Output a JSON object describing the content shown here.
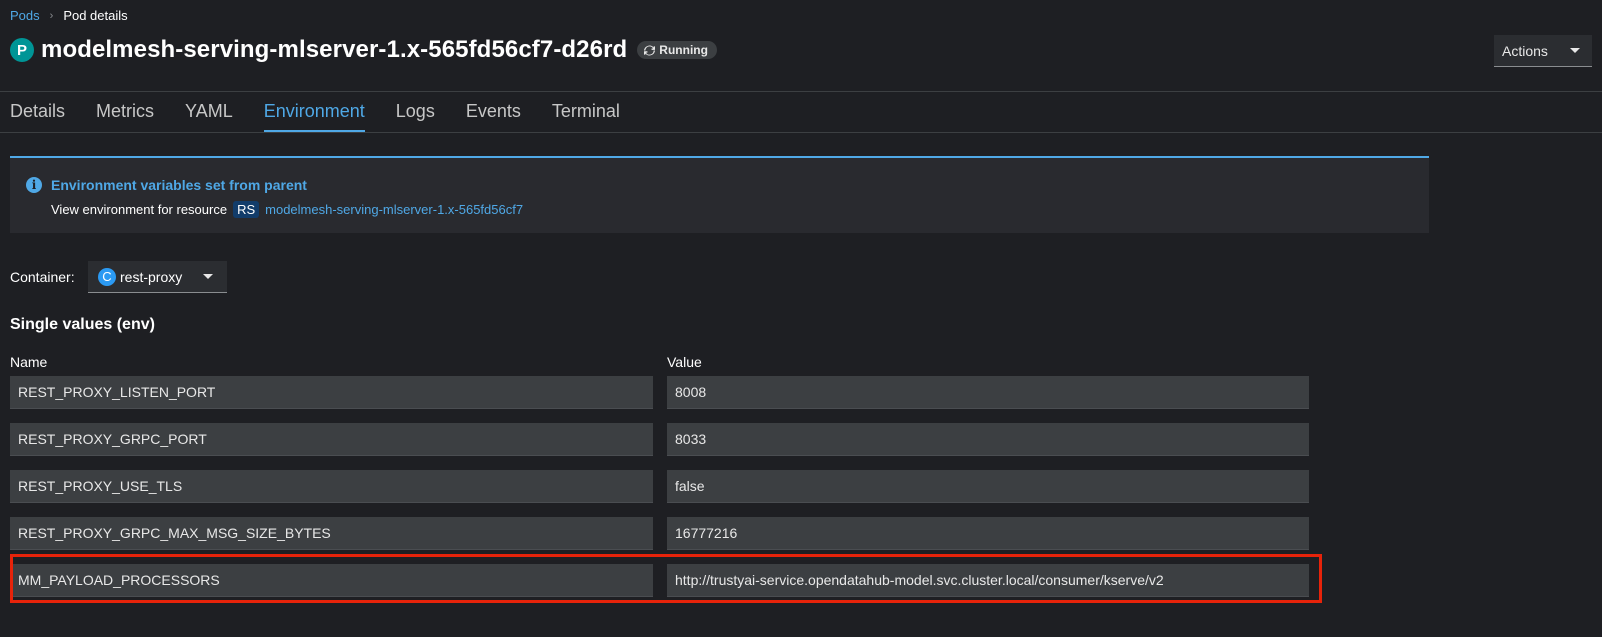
{
  "breadcrumb": {
    "parent": "Pods",
    "current": "Pod details"
  },
  "header": {
    "badge": "P",
    "title": "modelmesh-serving-mlserver-1.x-565fd56cf7-d26rd",
    "status": "Running",
    "actions_label": "Actions"
  },
  "tabs": [
    {
      "label": "Details"
    },
    {
      "label": "Metrics"
    },
    {
      "label": "YAML"
    },
    {
      "label": "Environment"
    },
    {
      "label": "Logs"
    },
    {
      "label": "Events"
    },
    {
      "label": "Terminal"
    }
  ],
  "active_tab": "Environment",
  "alert": {
    "title": "Environment variables set from parent",
    "body_prefix": "View environment for resource",
    "resource_badge": "RS",
    "resource_link": "modelmesh-serving-mlserver-1.x-565fd56cf7"
  },
  "container": {
    "label": "Container:",
    "badge": "C",
    "value": "rest-proxy"
  },
  "env": {
    "section_title": "Single values (env)",
    "name_header": "Name",
    "value_header": "Value",
    "rows": [
      {
        "name": "REST_PROXY_LISTEN_PORT",
        "value": "8008"
      },
      {
        "name": "REST_PROXY_GRPC_PORT",
        "value": "8033"
      },
      {
        "name": "REST_PROXY_USE_TLS",
        "value": "false"
      },
      {
        "name": "REST_PROXY_GRPC_MAX_MSG_SIZE_BYTES",
        "value": "16777216"
      },
      {
        "name": "MM_PAYLOAD_PROCESSORS",
        "value": "http://trustyai-service.opendatahub-model.svc.cluster.local/consumer/kserve/v2"
      }
    ]
  },
  "colors": {
    "accent": "#4fa8e6",
    "highlight": "#e7230a",
    "pod_badge": "#009596"
  },
  "icons": {
    "status": "sync-icon",
    "separator": "chevron-right-icon",
    "info": "info-circle-icon"
  }
}
